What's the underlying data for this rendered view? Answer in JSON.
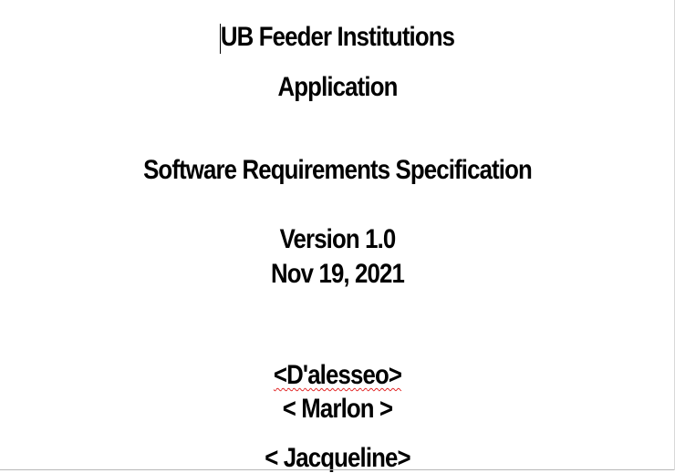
{
  "document": {
    "title": "UB Feeder Institutions",
    "subtitle": "Application",
    "doc_type": "Software Requirements Specification",
    "version": "Version 1.0",
    "date": "Nov 19, 2021",
    "authors": [
      "<D'alesseo>",
      "< Marlon >",
      "< Jacqueline>"
    ]
  }
}
